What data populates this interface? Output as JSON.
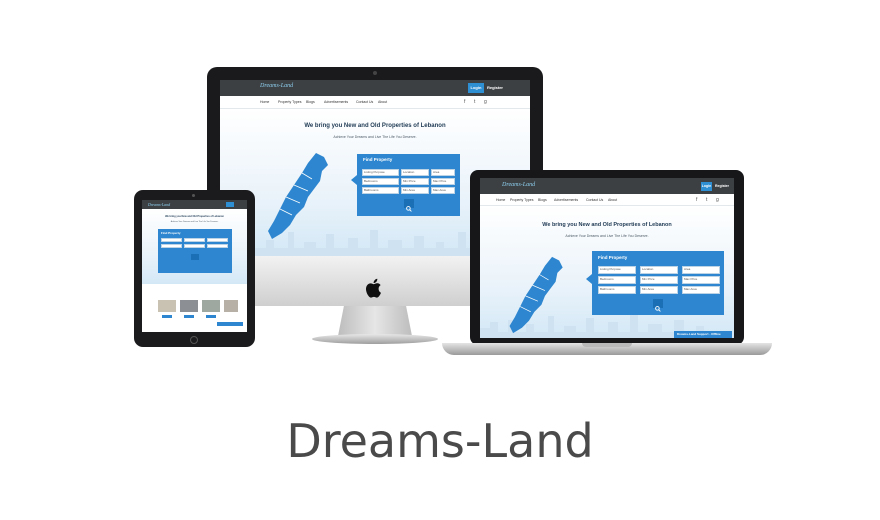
{
  "site": {
    "brand": "Dreams-Land",
    "login_label": "Login",
    "register_label": "Register",
    "nav_items": [
      "Home",
      "Property Types",
      "Blogs",
      "Advertisements",
      "Contact Us",
      "About"
    ],
    "headline": "We bring you New and Old Properties of Lebanon",
    "subline": "Achieve Your Dreams and Live The Life You Deserve.",
    "panel_title": "Find Property",
    "fields": [
      "Listing Purpose",
      "Location",
      "Area",
      "Bedrooms",
      "Min Price",
      "Max Price",
      "Bathrooms",
      "Min Area",
      "Max Area"
    ],
    "search_icon": "search-icon",
    "chat_label": "Dreams-Land Support - Offline",
    "colors": {
      "accent": "#2d86cf",
      "topbar": "#3c4043",
      "map": "#2d86cf"
    }
  },
  "footer": {
    "title": "Dreams-Land"
  }
}
